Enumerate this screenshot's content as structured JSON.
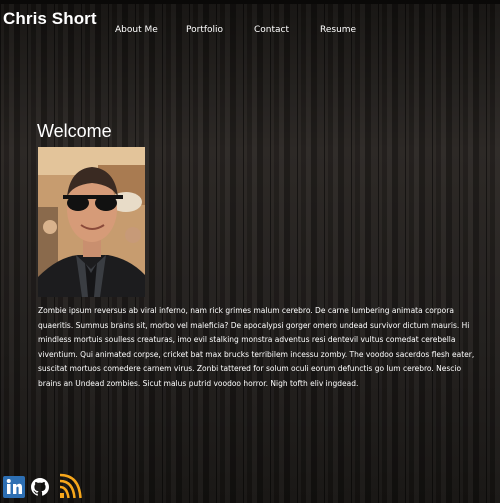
{
  "header": {
    "brand": "Chris Short"
  },
  "nav": {
    "items": [
      {
        "label": "About Me"
      },
      {
        "label": "Portfolio"
      },
      {
        "label": "Contact"
      },
      {
        "label": "Resume"
      }
    ]
  },
  "main": {
    "heading": "Welcome",
    "photo_alt": "Chris Short",
    "intro": "Zombie ipsum reversus ab viral inferno, nam rick grimes malum cerebro. De carne lumbering animata corpora quaeritis. Summus brains sit, morbo vel maleficia? De apocalypsi gorger omero undead survivor dictum mauris. Hi mindless mortuis soulless creaturas, imo evil stalking monstra adventus resi dentevil vultus comedat cerebella viventium. Qui animated corpse, cricket bat max brucks terribilem incessu zomby. The voodoo sacerdos flesh eater, suscitat mortuos comedere carnem virus. Zonbi tattered for solum oculi eorum defunctis go lum cerebro. Nescio brains an Undead zombies. Sicut malus putrid voodoo horror. Nigh tofth eliv ingdead."
  },
  "social": {
    "items": [
      {
        "icon": "linkedin-icon",
        "color": "#2d6fb3"
      },
      {
        "icon": "github-icon",
        "color": "#ffffff"
      },
      {
        "icon": "rss-icon",
        "color": "#f7a71b"
      }
    ]
  },
  "colors": {
    "background": "#1f1c1a",
    "text": "#ffffff"
  }
}
